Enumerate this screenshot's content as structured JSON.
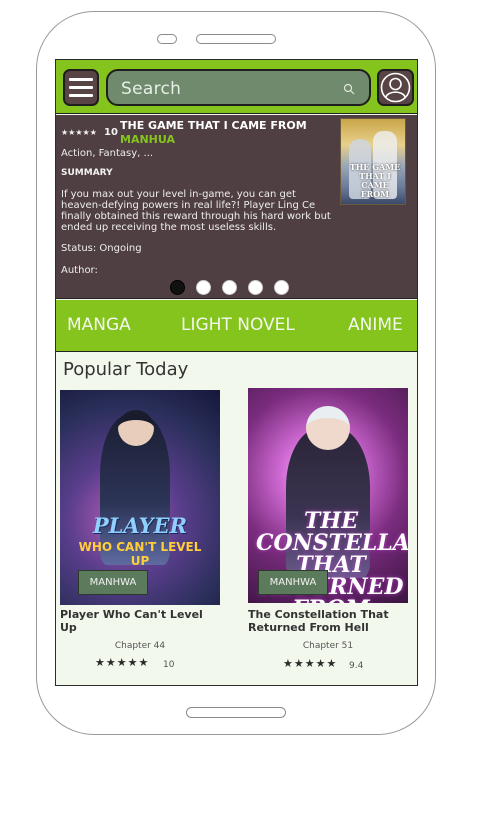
{
  "search": {
    "placeholder": "Search"
  },
  "featured": {
    "rating": "10",
    "title": "THE GAME THAT I CAME FROM",
    "type": "MANHUA",
    "genres": "Action, Fantasy, ...",
    "summary_heading": "SUMMARY",
    "summary": "If you max out your level in-game, you can get heaven-defying powers in real life?! Player Ling Ce finally obtained this reward through his hard work but ended up receiving the most useless skills.",
    "status": "Status: Ongoing",
    "author": "Author:",
    "cover_text": "THE GAME THAT I CAME FROM",
    "carousel_pages": 5,
    "active_page": 1
  },
  "tabs": [
    {
      "label": "MANGA"
    },
    {
      "label": "LIGHT NOVEL"
    },
    {
      "label": "ANIME"
    }
  ],
  "section_title": "Popular Today",
  "cards": [
    {
      "cover_title": "PLAYER",
      "cover_sub": "WHO CAN'T LEVEL UP",
      "badge": "MANHWA",
      "title": "Player Who Can't Level Up",
      "chapter": "Chapter 44",
      "rating": "10",
      "stars": 5
    },
    {
      "cover_title": "THE CONSTELLATION THAT RETURNED FROM HELL",
      "badge": "MANHWA",
      "title": "The Constellation That Returned From Hell",
      "chapter": "Chapter 51",
      "rating": "9.4",
      "stars": 5
    }
  ],
  "colors": {
    "accent": "#84c41c",
    "featured_bg": "#4f3f42",
    "button_bg": "#584444",
    "search_bg": "#6f8a6c",
    "screen_bg": "#f2f8ec",
    "badge_bg": "#5c7a5c"
  },
  "icons": {
    "menu": "hamburger-icon",
    "search": "search-icon",
    "profile": "user-icon",
    "star": "star-icon"
  }
}
